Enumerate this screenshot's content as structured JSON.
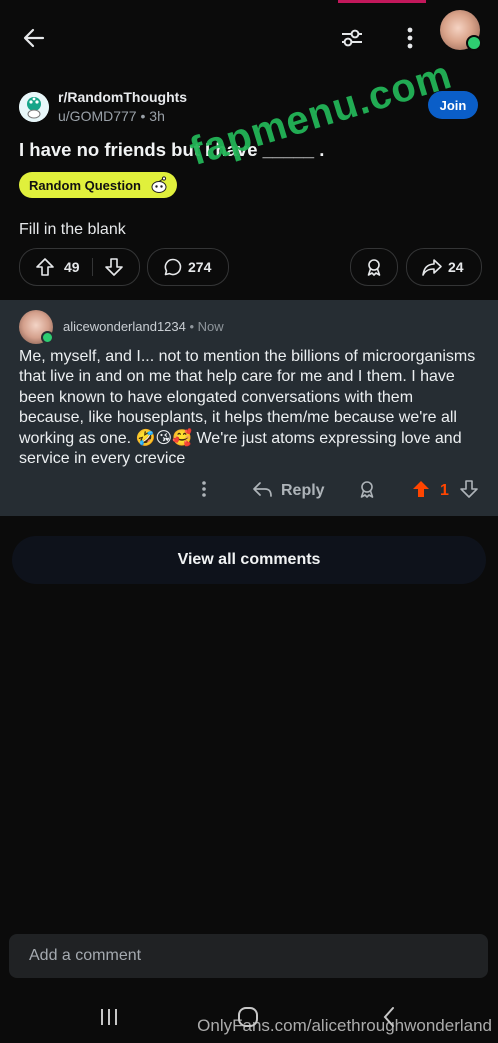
{
  "post": {
    "subreddit": "r/RandomThoughts",
    "author": "u/GOMD777",
    "age": "3h",
    "join_label": "Join",
    "title": "I have no friends but I have _____ .",
    "flair": "Random Question",
    "body": "Fill in the blank",
    "upvotes": "49",
    "comments": "274",
    "shares": "24"
  },
  "comment": {
    "username": "alicewonderland1234",
    "time": "Now",
    "body": "Me, myself, and I... not to mention the billions of microorganisms that live in and on me that help care for me and I them. I have been known to have elongated conversations with them because, like houseplants, it helps them/me because we're all working as one. 🤣😘🥰 We're just atoms expressing love and service in every crevice",
    "reply_label": "Reply",
    "score": "1"
  },
  "view_all_label": "View all comments",
  "add_comment_placeholder": "Add a comment",
  "watermarks": {
    "site": "fapmenu.com",
    "onlyfans": "OnlyFans.com/alicethroughwonderland"
  },
  "icons": {
    "back": "back-arrow-icon",
    "filter": "filter-sliders-icon",
    "more": "more-vertical-icon",
    "upvote": "upvote-arrow-icon",
    "downvote": "downvote-arrow-icon",
    "comment": "comment-bubble-icon",
    "award": "award-icon",
    "share": "share-arrow-icon",
    "reply": "reply-arrow-icon"
  },
  "colors": {
    "join": "#0a5ec8",
    "flair": "#e0f03c",
    "upvoted": "#ff4500",
    "online": "#2ecc71",
    "watermark": "#23b457"
  }
}
